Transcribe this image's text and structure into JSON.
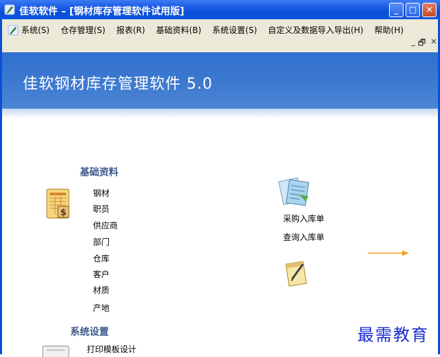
{
  "window": {
    "title": "佳软软件 – [钢材库存管理软件试用版]"
  },
  "menu": {
    "items": [
      "系统(S)",
      "仓存管理(S)",
      "报表(R)",
      "基础资料(B)",
      "系统设置(S)",
      "自定义及数据导入导出(H)",
      "帮助(H)"
    ],
    "mdi_controls": [
      "_",
      "🗗",
      "×"
    ]
  },
  "banner": {
    "title": "佳软钢材库存管理软件 5.0"
  },
  "basic_data": {
    "title": "基础资料",
    "items": [
      "钢材",
      "职员",
      "供应商",
      "部门",
      "仓库",
      "客户",
      "材质",
      "产地"
    ]
  },
  "purchase": {
    "items": [
      "采购入库单",
      "查询入库单"
    ]
  },
  "system_settings": {
    "title": "系统设置",
    "items": [
      "打印模板设计"
    ]
  },
  "watermark": "最需教育",
  "colors": {
    "titlebar": "#0a4fd8",
    "banner": "#3d79cf",
    "arrow": "#f0a020",
    "section_title": "#3d5a8a"
  }
}
